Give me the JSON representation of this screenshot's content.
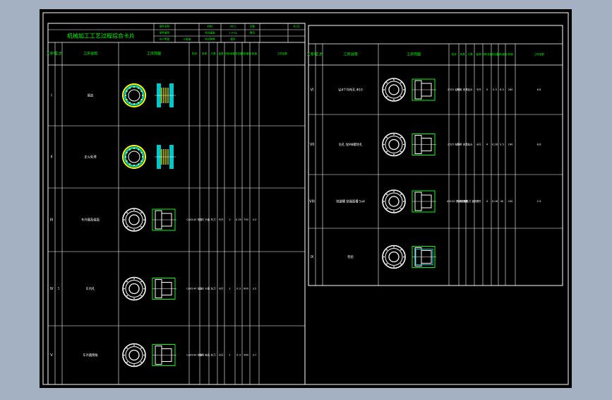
{
  "colors": {
    "background": "#a3b1c2",
    "sheet": "#000000",
    "frame": "#ffffff",
    "header_text": "#00ff00",
    "cell_text": "#ffffff",
    "part_outline": "#ffffff",
    "section_fill": "#00c8c8",
    "section_line": "#ffff00",
    "fixture": "#00ff00"
  },
  "left_sheet": {
    "title": "机械加工工艺过程综合卡片",
    "header_cells": [
      "零件名称",
      "",
      "材料",
      "45Cr",
      "页数",
      "",
      "共1页",
      "零件编号",
      "",
      "毛坯重量",
      "1.4 kg",
      "第页",
      "",
      "",
      "生产类型",
      "小批量",
      "毛坯种类",
      "锻件",
      "",
      "",
      ""
    ],
    "columns": {
      "seq": "工序号",
      "step": "工步",
      "desc": "工序说明",
      "sketch": "工序简图",
      "machine": "机床",
      "fixture": "夹具",
      "tool": "刀具",
      "measure": "量具",
      "cut_depth": "切削深度",
      "feed": "进给量",
      "speed": "切削速度",
      "rpm": "转速",
      "time": "工时定额"
    },
    "rows": [
      {
        "seq": "I",
        "step": "",
        "desc": "锻造",
        "sketch": "ring-filled",
        "cells": [
          "",
          "",
          "",
          "",
          "",
          "",
          "",
          "",
          ""
        ]
      },
      {
        "seq": "II",
        "step": "",
        "desc": "正火处理",
        "sketch": "ring-filled",
        "cells": [
          "",
          "",
          "",
          "",
          "",
          "",
          "",
          "",
          ""
        ]
      },
      {
        "seq": "III",
        "step": "",
        "desc": "车外圆及端面",
        "sketch": "ring-fixture",
        "cells": [
          "CA6140 车床",
          "三爪 卡盘",
          "车刀",
          "卡尺",
          "2",
          "0.35",
          "750",
          "4.2",
          ""
        ]
      },
      {
        "seq": "IV",
        "step": "1",
        "desc": "车内孔",
        "sketch": "ring-fixture",
        "cells": [
          "CA6140 车床",
          "三爪 卡盘",
          "车刀",
          "卡尺",
          "2",
          "0.3",
          "600",
          "3.5",
          ""
        ]
      },
      {
        "seq": "V",
        "step": "",
        "desc": "车外圆倒角",
        "sketch": "ring-fixture",
        "cells": [
          "CA6140 车床",
          "专用 夹具",
          "车刀",
          "卡尺",
          "1",
          "0.3",
          "560",
          "3.7",
          ""
        ]
      }
    ]
  },
  "right_sheet": {
    "columns": {
      "seq": "工序号",
      "step": "工步",
      "desc": "工序说明",
      "sketch": "工序简图",
      "machine": "机床",
      "fixture": "夹具",
      "tool": "刀具",
      "measure": "量具",
      "cut_depth": "切削深度",
      "feed": "进给量",
      "speed": "切削速度",
      "rpm": "转速",
      "time": "工时定额"
    },
    "rows": [
      {
        "seq": "VI",
        "step": "",
        "desc": "钻4个均布孔 Φ10",
        "sketch": "ring-fixture",
        "cells": [
          "Z525 钻床",
          "专用 夹具",
          "钻头",
          "卡尺",
          "5",
          "0.3",
          "8.5",
          "260",
          "6.8"
        ]
      },
      {
        "seq": "VII",
        "step": "",
        "desc": "钻孔 攻M8螺纹孔",
        "sketch": "ring-fixture",
        "cells": [
          "Z525 钻床",
          "专用 夹具",
          "钻头",
          "卡尺",
          "4",
          "0.28",
          "9.5",
          "240",
          "8.6"
        ]
      },
      {
        "seq": "VIII",
        "step": "",
        "desc": "铣键槽 铣端面槽 5x4",
        "sketch": "ring-fixture",
        "cells": [
          "X6132 铣床",
          "专用 夹具",
          "键槽铣刀 盘铣刀",
          "卡尺",
          "4",
          "0.06",
          "40",
          "200",
          "2.9"
        ]
      },
      {
        "seq": "IX",
        "step": "",
        "desc": "检验",
        "sketch": "ring-assembly",
        "cells": [
          "",
          "",
          "",
          "",
          "",
          "",
          "",
          "",
          ""
        ]
      }
    ]
  }
}
